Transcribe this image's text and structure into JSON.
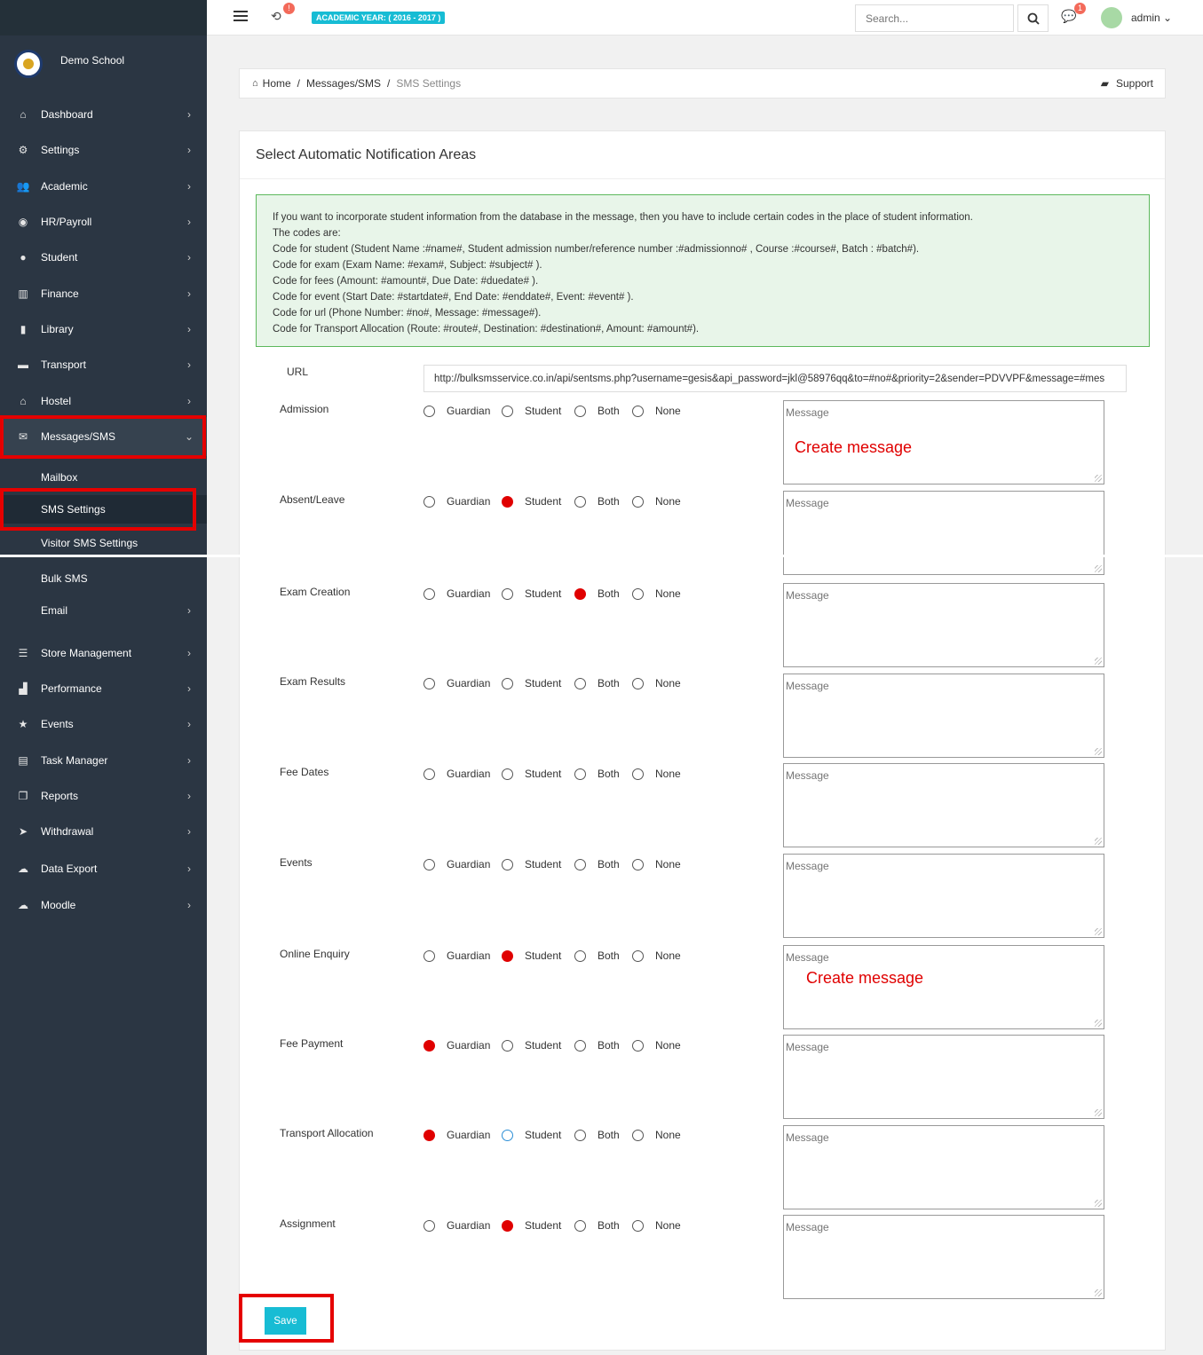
{
  "sidebar": {
    "school_name": "Demo School",
    "items": [
      {
        "label": "Dashboard",
        "icon": "home-icon",
        "glyph": "⌂"
      },
      {
        "label": "Settings",
        "icon": "gears-icon",
        "glyph": "⚙"
      },
      {
        "label": "Academic",
        "icon": "users-icon",
        "glyph": "👥"
      },
      {
        "label": "HR/Payroll",
        "icon": "eye-icon",
        "glyph": "◉"
      },
      {
        "label": "Student",
        "icon": "user-icon",
        "glyph": "●"
      },
      {
        "label": "Finance",
        "icon": "bank-icon",
        "glyph": "▥"
      },
      {
        "label": "Library",
        "icon": "book-icon",
        "glyph": "▮"
      },
      {
        "label": "Transport",
        "icon": "truck-icon",
        "glyph": "▬"
      },
      {
        "label": "Hostel",
        "icon": "house-icon",
        "glyph": "⌂"
      },
      {
        "label": "Messages/SMS",
        "icon": "envelope-icon",
        "glyph": "✉"
      }
    ],
    "sub_items": [
      {
        "label": "Mailbox"
      },
      {
        "label": "SMS Settings"
      },
      {
        "label": "Visitor SMS Settings"
      },
      {
        "label": "Bulk SMS"
      },
      {
        "label": "Email"
      }
    ],
    "items2": [
      {
        "label": "Store Management",
        "icon": "list-icon",
        "glyph": "☰"
      },
      {
        "label": "Performance",
        "icon": "bar-chart-icon",
        "glyph": "▟"
      },
      {
        "label": "Events",
        "icon": "star-icon",
        "glyph": "★"
      },
      {
        "label": "Task Manager",
        "icon": "tasks-icon",
        "glyph": "▤"
      },
      {
        "label": "Reports",
        "icon": "copy-icon",
        "glyph": "❐"
      },
      {
        "label": "Withdrawal",
        "icon": "send-icon",
        "glyph": "➤"
      },
      {
        "label": "Data Export",
        "icon": "cloud-download-icon",
        "glyph": "☁"
      },
      {
        "label": "Moodle",
        "icon": "cloud-upload-icon",
        "glyph": "☁"
      }
    ]
  },
  "header": {
    "academic_year": "ACADEMIC YEAR: ( 2016 - 2017 )",
    "sync_badge": "!",
    "search_placeholder": "Search...",
    "chat_badge": "1",
    "user": "admin"
  },
  "breadcrumb": {
    "home": "Home",
    "section": "Messages/SMS",
    "current": "SMS Settings",
    "support": "Support"
  },
  "card": {
    "title": "Select Automatic Notification Areas",
    "info_lines": [
      "If you want to incorporate student information from the database in the message, then you have to include certain codes in the place of student information.",
      "The codes are:",
      "Code for student (Student Name :#name#, Student admission number/reference number :#admissionno# , Course :#course#, Batch : #batch#).",
      "Code for exam (Exam Name: #exam#, Subject: #subject# ).",
      "Code for fees (Amount: #amount#, Due Date: #duedate# ).",
      "Code for event (Start Date: #startdate#, End Date: #enddate#, Event: #event# ).",
      "Code for url (Phone Number: #no#, Message: #message#).",
      "Code for Transport Allocation (Route: #route#, Destination: #destination#, Amount: #amount#)."
    ],
    "url_label": "URL",
    "url_value": "http://bulksmsservice.co.in/api/sentsms.php?username=gesis&api_password=jkl@58976qq&to=#no#&priority=2&sender=PDVVPF&message=#mes",
    "options": [
      "Guardian",
      "Student",
      "Both",
      "None"
    ],
    "message_placeholder": "Message",
    "rows": [
      {
        "label": "Admission",
        "selected": "",
        "note": "Create message"
      },
      {
        "label": "Absent/Leave",
        "selected": "Student",
        "note": ""
      },
      {
        "label": "Exam Creation",
        "selected": "Both",
        "note": ""
      },
      {
        "label": "Exam Results",
        "selected": "",
        "note": ""
      },
      {
        "label": "Fee Dates",
        "selected": "",
        "note": ""
      },
      {
        "label": "Events",
        "selected": "",
        "note": ""
      },
      {
        "label": "Online Enquiry",
        "selected": "Student",
        "note": "Create message"
      },
      {
        "label": "Fee Payment",
        "selected": "Guardian",
        "note": ""
      },
      {
        "label": "Transport Allocation",
        "selected": "Guardian",
        "note": ""
      },
      {
        "label": "Assignment",
        "selected": "Student",
        "note": ""
      }
    ],
    "save_label": "Save"
  },
  "colors": {
    "sidebar_bg": "#2b3643",
    "accent": "#17bcd4",
    "highlight": "#e50000",
    "alert_bg": "#e8f5e9"
  }
}
